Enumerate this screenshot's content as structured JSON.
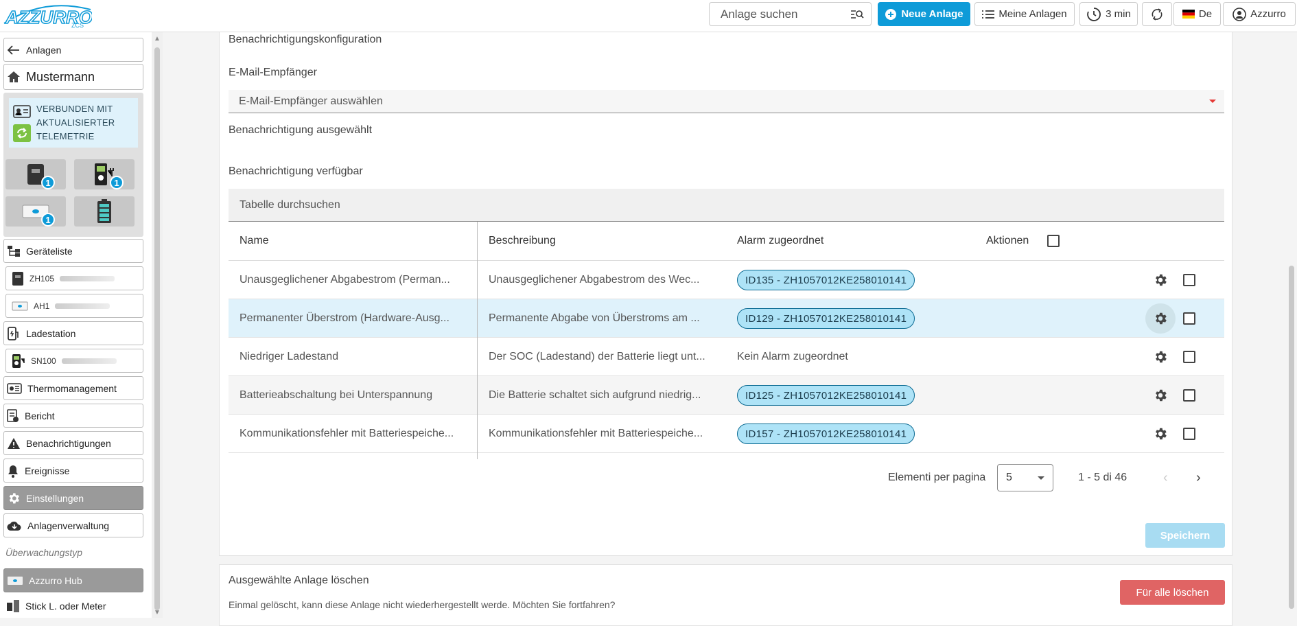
{
  "topbar": {
    "logo_text": "AZZURRO",
    "logo_sub": "ZCS",
    "search_placeholder": "Anlage suchen",
    "new_plant": "Neue Anlage",
    "my_plants": "Meine Anlagen",
    "interval": "3 min",
    "language": "De",
    "user": "Azzurro",
    "accent": "#0e9bd8"
  },
  "sidebar": {
    "back": "Anlagen",
    "plant_name": "Mustermann",
    "status_line1": "VERBUNDEN MIT",
    "status_line2": "AKTUALISIERTER",
    "status_line3": "TELEMETRIE",
    "badges": [
      "1",
      "1",
      "1"
    ],
    "device_list": "Geräteliste",
    "inverter_sn": "ZH105",
    "meter_sn": "AH1",
    "charging": "Ladestation",
    "charger_sn": "SN100",
    "thermo": "Thermomanagement",
    "report": "Bericht",
    "notifications": "Benachrichtigungen",
    "events": "Ereignisse",
    "settings": "Einstellungen",
    "plant_mgmt": "Anlagenverwaltung",
    "monitoring_type": "Überwachungstyp",
    "hub": "Azzurro Hub",
    "stick": "Stick L. oder Meter"
  },
  "config": {
    "title": "Benachrichtigungskonfiguration",
    "email_label": "E-Mail-Empfänger",
    "email_placeholder": "E-Mail-Empfänger auswählen",
    "selected_label": "Benachrichtigung ausgewählt",
    "available_label": "Benachrichtigung verfügbar",
    "table_search": "Tabelle durchsuchen"
  },
  "table": {
    "headers": {
      "name": "Name",
      "desc": "Beschreibung",
      "alarm": "Alarm zugeordnet",
      "actions": "Aktionen"
    },
    "rows": [
      {
        "name": "Unausgeglichener Abgabestrom (Perman...",
        "desc": "Unausgeglichener Abgabestrom des Wec...",
        "alarm": "ID135 - ZH1057012KE258010141",
        "chip": true
      },
      {
        "name": "Permanenter Überstrom (Hardware-Ausg...",
        "desc": "Permanente Abgabe von Überstroms am ...",
        "alarm": "ID129 - ZH1057012KE258010141",
        "chip": true
      },
      {
        "name": "Niedriger Ladestand",
        "desc": "Der SOC (Ladestand) der Batterie liegt unt...",
        "alarm": "Kein Alarm zugeordnet",
        "chip": false
      },
      {
        "name": "Batterieabschaltung bei Unterspannung",
        "desc": "Die Batterie schaltet sich aufgrund niedrig...",
        "alarm": "ID125 - ZH1057012KE258010141",
        "chip": true
      },
      {
        "name": "Kommunikationsfehler mit Batteriespeiche...",
        "desc": "Kommunikationsfehler mit Batteriespeiche...",
        "alarm": "ID157 - ZH1057012KE258010141",
        "chip": true
      }
    ]
  },
  "pagination": {
    "label": "Elementi per pagina",
    "per_page": "5",
    "range": "1 - 5 di 46"
  },
  "save": "Speichern",
  "delete_section": {
    "title": "Ausgewählte Anlage löschen",
    "text": "Einmal gelöscht, kann diese Anlage nicht wiederhergestellt werde. Möchten Sie fortfahren?",
    "button": "Für alle löschen"
  }
}
